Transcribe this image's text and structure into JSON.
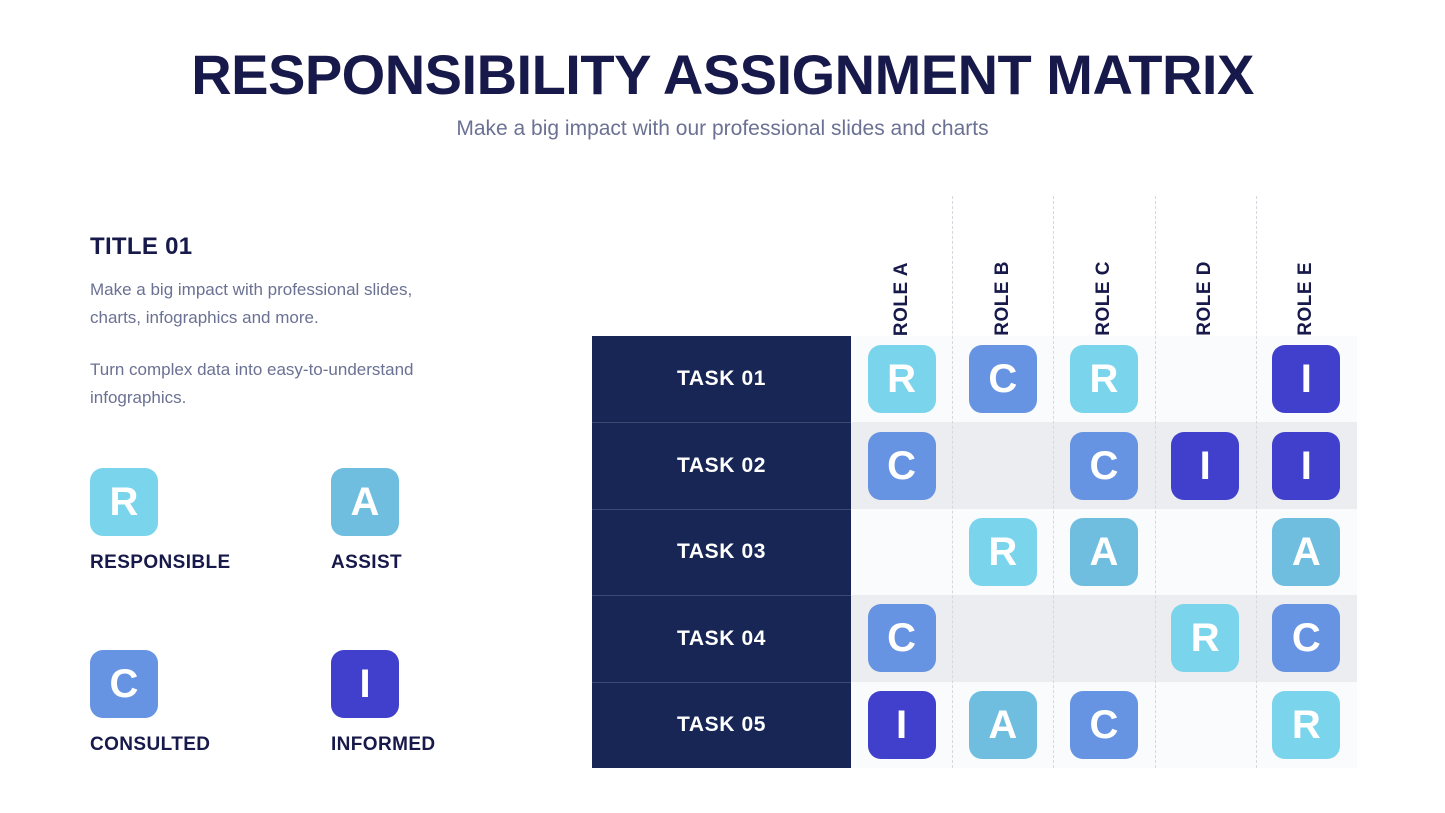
{
  "header": {
    "title": "RESPONSIBILITY ASSIGNMENT MATRIX",
    "subtitle": "Make a big impact with our professional slides and charts"
  },
  "left_panel": {
    "title": "TITLE 01",
    "paragraph_1": "Make a big impact with professional slides, charts, infographics and more.",
    "paragraph_2": "Turn complex data into easy-to-understand infographics."
  },
  "legend": {
    "items": [
      {
        "key": "R",
        "label": "RESPONSIBLE",
        "color": "#7ad5ec"
      },
      {
        "key": "A",
        "label": "ASSIST",
        "color": "#6fbee0"
      },
      {
        "key": "C",
        "label": "CONSULTED",
        "color": "#6694e3"
      },
      {
        "key": "I",
        "label": "INFORMED",
        "color": "#4040cc"
      }
    ]
  },
  "colors": {
    "navy": "#172654",
    "title": "#17194a",
    "body_text": "#6b7193",
    "row_odd": "#fafbfc",
    "row_even": "#ecedf0",
    "grid_line": "#d5d8de",
    "R": "#7ad5ec",
    "A": "#6fbee0",
    "C": "#6694e3",
    "I": "#4040cc"
  },
  "chart_data": {
    "type": "table",
    "title": "RESPONSIBILITY ASSIGNMENT MATRIX",
    "columns": [
      "ROLE A",
      "ROLE B",
      "ROLE C",
      "ROLE D",
      "ROLE E"
    ],
    "rows": [
      "TASK 01",
      "TASK 02",
      "TASK 03",
      "TASK 04",
      "TASK 05"
    ],
    "values": [
      [
        "R",
        "C",
        "R",
        "",
        "I"
      ],
      [
        "C",
        "",
        "C",
        "I",
        "I"
      ],
      [
        "",
        "R",
        "A",
        "",
        "A"
      ],
      [
        "C",
        "",
        "",
        "R",
        "C"
      ],
      [
        "I",
        "A",
        "C",
        "",
        "R"
      ]
    ],
    "legend": [
      "R = RESPONSIBLE",
      "A = ASSIST",
      "C = CONSULTED",
      "I = INFORMED"
    ],
    "xlabel": "",
    "ylabel": "",
    "grid": true,
    "legend_position": "left"
  }
}
